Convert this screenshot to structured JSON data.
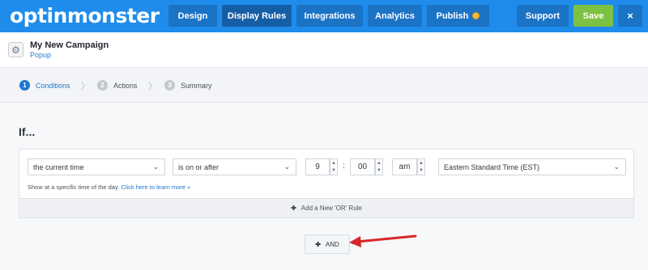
{
  "logo": {
    "text_left": "optinm",
    "text_o": "o",
    "text_right": "nster"
  },
  "nav": {
    "design": "Design",
    "display_rules": "Display Rules",
    "integrations": "Integrations",
    "analytics": "Analytics",
    "publish": "Publish",
    "support": "Support",
    "save": "Save",
    "close": "×"
  },
  "campaign": {
    "title": "My New Campaign",
    "type": "Popup"
  },
  "steps": [
    {
      "num": "1",
      "label": "Conditions"
    },
    {
      "num": "2",
      "label": "Actions"
    },
    {
      "num": "3",
      "label": "Summary"
    }
  ],
  "rules": {
    "heading": "If...",
    "condition_select": "the current time",
    "operator_select": "is on or after",
    "hour": "9",
    "separator": ":",
    "minute": "00",
    "ampm": "am",
    "timezone_select": "Eastern Standard Time (EST)",
    "hint_text": "Show at a specific time of the day.",
    "hint_link": "Click here to learn more »",
    "add_or_label": "Add a New 'OR' Rule",
    "and_label": "AND"
  },
  "colors": {
    "topbar": "#1f8ceb",
    "nav_button": "#1b73c6",
    "save": "#7cc142",
    "accent": "#1f76d2",
    "arrow": "#d9262b"
  }
}
